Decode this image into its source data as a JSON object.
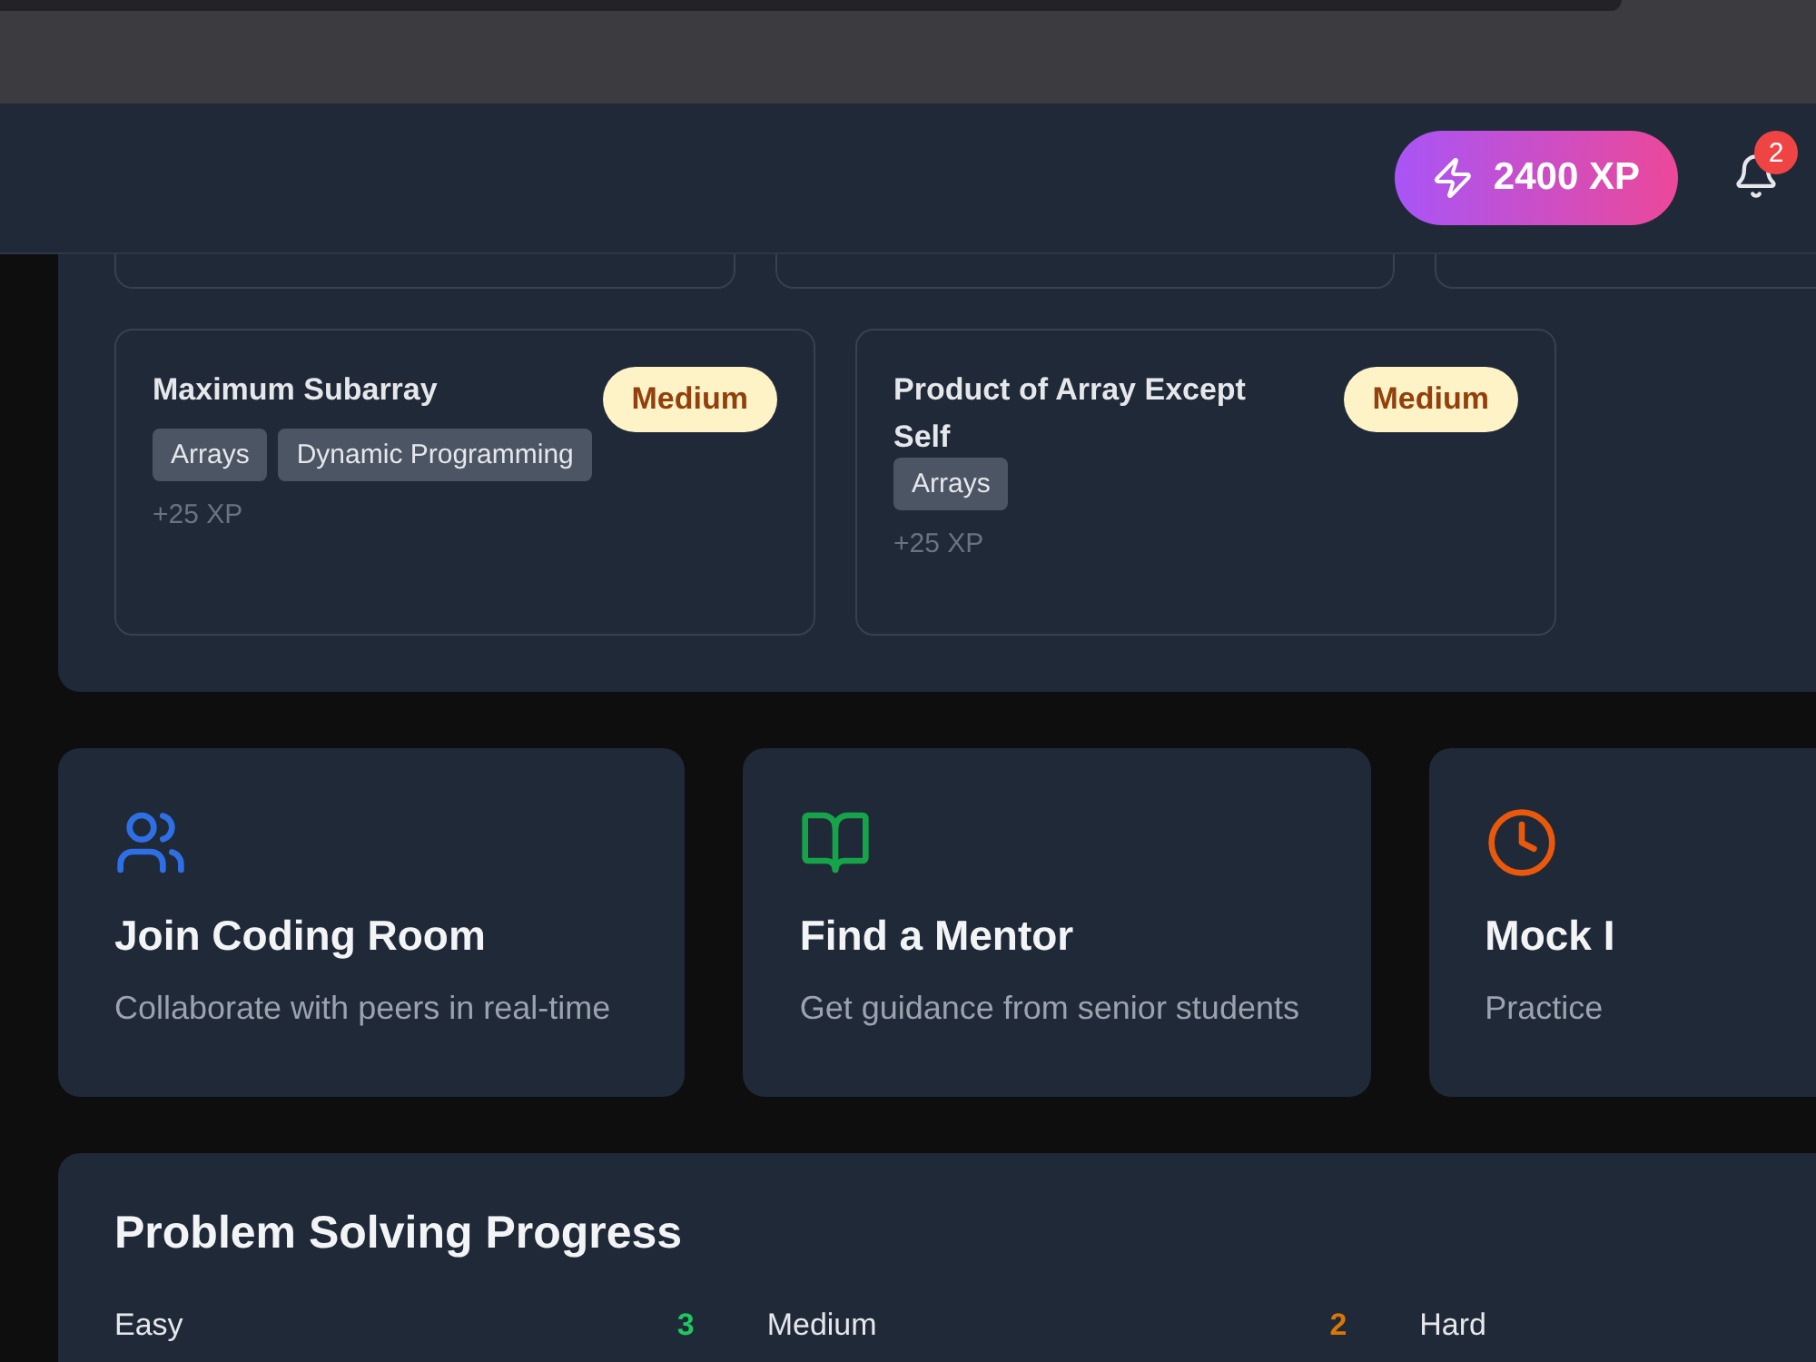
{
  "header": {
    "xp": "2400 XP",
    "notification_count": "2"
  },
  "problems": [
    {
      "title": "Maximum Subarray",
      "difficulty": "Medium",
      "kind": "medium",
      "tags": [
        "Arrays",
        "Dynamic Programming"
      ],
      "xp": "+25 XP"
    },
    {
      "title": "Product of Array Except Self",
      "difficulty": "Medium",
      "kind": "medium",
      "tags": [
        "Arrays"
      ],
      "xp": "+25 XP"
    }
  ],
  "actions": [
    {
      "kind": "users",
      "color": "#2f6fe4",
      "title": "Join Coding Room",
      "description": "Collaborate with peers in real-time"
    },
    {
      "kind": "book",
      "color": "#16a34a",
      "title": "Find a Mentor",
      "description": "Get guidance from senior students"
    },
    {
      "kind": "clock",
      "color": "#ea580c",
      "title": "Mock I",
      "description": "Practice"
    }
  ],
  "progress": {
    "title": "Problem Solving Progress",
    "items": [
      {
        "label": "Easy",
        "count": "3",
        "color": "#22c55e"
      },
      {
        "label": "Medium",
        "count": "2",
        "color": "#d97706"
      },
      {
        "label": "Hard"
      }
    ]
  }
}
